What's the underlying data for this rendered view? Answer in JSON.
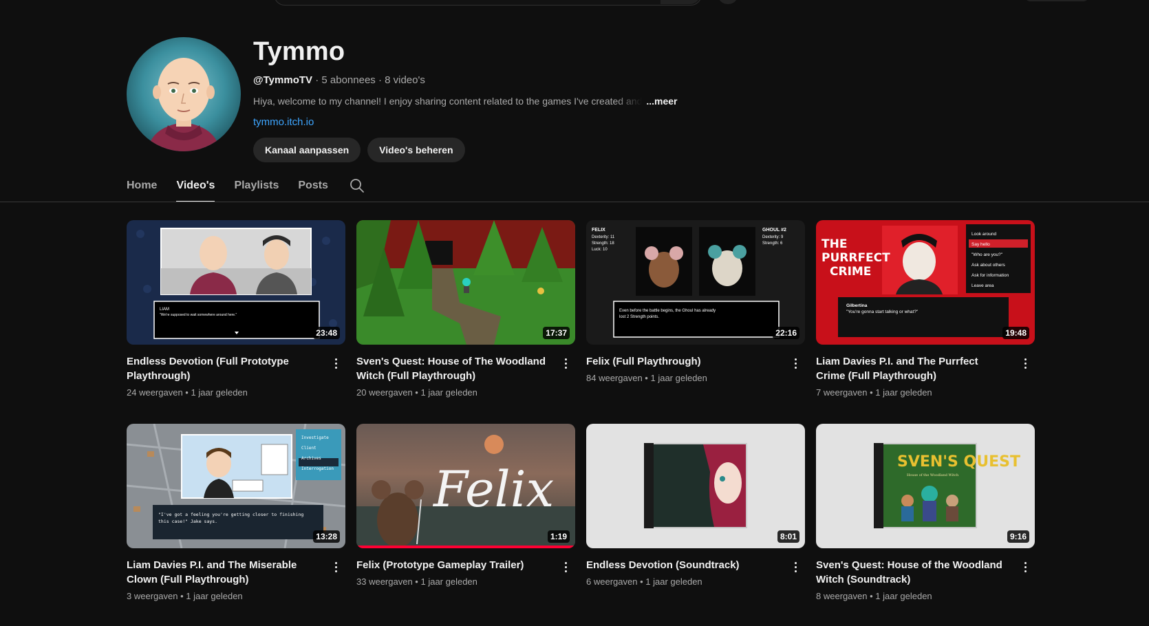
{
  "channel": {
    "name": "Tymmo",
    "handle": "@TymmoTV",
    "subscribers": "5 abonnees",
    "video_count": "8 video's",
    "separator": "·",
    "description": "Hiya, welcome to my channel! I enjoy sharing content related to the games I've created and",
    "more_label": "...meer",
    "link": "tymmo.itch.io"
  },
  "buttons": {
    "customize": "Kanaal aanpassen",
    "manage": "Video's beheren"
  },
  "tabs": [
    {
      "label": "Home"
    },
    {
      "label": "Video's",
      "active": true
    },
    {
      "label": "Playlists"
    },
    {
      "label": "Posts"
    }
  ],
  "videos": [
    {
      "title": "Endless Devotion (Full Prototype Playthrough)",
      "views": "24 weergaven",
      "age": "1 jaar geleden",
      "duration": "23:48",
      "thumb_text": "LIAM",
      "thumb_sub": "\"We're supposed to wait somewhere around here.\""
    },
    {
      "title": "Sven's Quest: House of The Woodland Witch (Full Playthrough)",
      "views": "20 weergaven",
      "age": "1 jaar geleden",
      "duration": "17:37"
    },
    {
      "title": "Felix (Full Playthrough)",
      "views": "84 weergaven",
      "age": "1 jaar geleden",
      "duration": "22:16",
      "thumb_left": "FELIX",
      "thumb_left_stats": [
        "Dexterity: 11",
        "Strength: 18",
        "Luck: 10"
      ],
      "thumb_right": "GHOUL #2",
      "thumb_right_stats": [
        "Dexterity: 9",
        "Strength: 6"
      ],
      "thumb_caption": [
        "Even before the battle begins, the Ghoul has already",
        "lost 2 Strength points."
      ]
    },
    {
      "title": "Liam Davies P.I. and The Purrfect Crime (Full Playthrough)",
      "views": "7 weergaven",
      "age": "1 jaar geleden",
      "duration": "19:48",
      "thumb_logo": [
        "THE",
        "PURRFECT",
        "CRIME"
      ],
      "thumb_menu": [
        "Look around",
        "Say hello",
        "\"Who are you?\"",
        "Ask about others",
        "Ask for information",
        "Leave area"
      ],
      "thumb_speaker": "Gilbertina",
      "thumb_line": "\"You're gonna start talking or what?\""
    },
    {
      "title": "Liam Davies P.I. and The Miserable Clown (Full Playthrough)",
      "views": "3 weergaven",
      "age": "1 jaar geleden",
      "duration": "13:28",
      "thumb_menu": [
        "Investigate",
        "Client",
        "Archives",
        "Interrogation"
      ],
      "thumb_line": [
        "\"I've got a feeling you're getting closer to finishing",
        "this case!\" Jake says."
      ]
    },
    {
      "title": "Felix (Prototype Gameplay Trailer)",
      "views": "33 weergaven",
      "age": "1 jaar geleden",
      "duration": "1:19",
      "thumb_logo": "Felix",
      "progress": 1.0
    },
    {
      "title": "Endless Devotion (Soundtrack)",
      "views": "6 weergaven",
      "age": "1 jaar geleden",
      "duration": "8:01"
    },
    {
      "title": "Sven's Quest: House of the Woodland Witch (Soundtrack)",
      "views": "8 weergaven",
      "age": "1 jaar geleden",
      "duration": "9:16",
      "thumb_logo": "SVEN'S QUEST",
      "thumb_sub": "House of the Woodland Witch"
    }
  ],
  "meta_separator": "•",
  "colors": {
    "background": "#0f0f0f",
    "link": "#3ea6ff",
    "button": "#272727",
    "progress": "#ff0033"
  },
  "icons": [
    "search-icon",
    "more-vert-icon"
  ]
}
